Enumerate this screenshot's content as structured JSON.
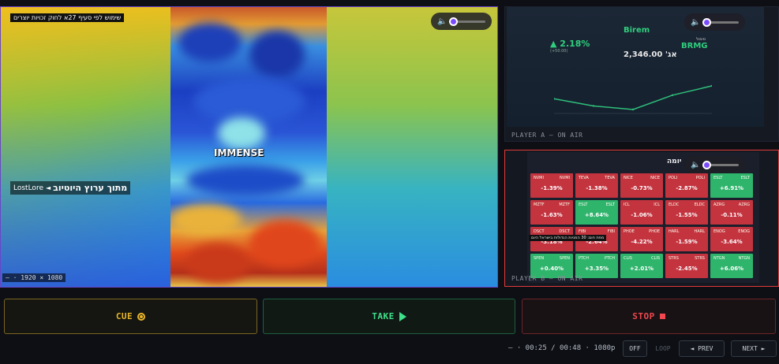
{
  "main_preview": {
    "caption": "שימוש לפי סעיף 27א לחוק זכויות יוצרים",
    "source_tag": {
      "source": "LostLore",
      "text": "מתוך ערוץ היוטיוב"
    },
    "overlay_word": "IMMENSE",
    "resolution": "— · 1920 × 1080",
    "volume_icon": "speaker-icon"
  },
  "player_a": {
    "label": "PLAYER A — ON AIR",
    "ticker": {
      "change_pct": "▲ 2.18%",
      "change_sub": "(+50.00)",
      "company_latin": "Birem",
      "price": "2,346.00 'אג",
      "small_label": "סימול",
      "symbol": "BRMG"
    },
    "chart_data": {
      "type": "line",
      "x": [
        1,
        2,
        3,
        4,
        5
      ],
      "values": [
        2310,
        2290,
        2280,
        2320,
        2346
      ]
    }
  },
  "player_b": {
    "label": "PLAYER B — ON AIR",
    "title": "יומה",
    "overlay": "מפת חום: 30 המניות הגדולות בישראל היום",
    "cells": [
      {
        "t": "NVMI",
        "t2": "NVMI",
        "v": "-1.39%",
        "c": "r"
      },
      {
        "t": "TEVA",
        "t2": "TEVA",
        "v": "-1.38%",
        "c": "r"
      },
      {
        "t": "NICE",
        "t2": "NICE",
        "v": "-0.73%",
        "c": "r"
      },
      {
        "t": "POLI",
        "t2": "POLI",
        "v": "-2.87%",
        "c": "r"
      },
      {
        "t": "ESLT",
        "t2": "ESLT",
        "v": "+6.91%",
        "c": "g"
      },
      {
        "t": "MZTF",
        "t2": "MZTF",
        "v": "-1.63%",
        "c": "r"
      },
      {
        "t": "ESLT",
        "t2": "ESLT",
        "v": "+8.64%",
        "c": "g"
      },
      {
        "t": "ICL",
        "t2": "ICL",
        "v": "-1.06%",
        "c": "r"
      },
      {
        "t": "ELDC",
        "t2": "ELDC",
        "v": "-1.55%",
        "c": "r"
      },
      {
        "t": "AZRG",
        "t2": "AZRG",
        "v": "-0.11%",
        "c": "r"
      },
      {
        "t": "DSCT",
        "t2": "DSCT",
        "v": "-3.18%",
        "c": "r"
      },
      {
        "t": "FIBI",
        "t2": "FIBI",
        "v": "-2.64%",
        "c": "r"
      },
      {
        "t": "PHOE",
        "t2": "PHOE",
        "v": "-4.22%",
        "c": "r"
      },
      {
        "t": "HARL",
        "t2": "HARL",
        "v": "-1.59%",
        "c": "r"
      },
      {
        "t": "ENOG",
        "t2": "ENOG",
        "v": "-3.64%",
        "c": "r"
      },
      {
        "t": "SPEN",
        "t2": "SPEN",
        "v": "+0.40%",
        "c": "g"
      },
      {
        "t": "PTCH",
        "t2": "PTCH",
        "v": "+3.35%",
        "c": "g"
      },
      {
        "t": "CLIS",
        "t2": "CLIS",
        "v": "+2.01%",
        "c": "g"
      },
      {
        "t": "STRS",
        "t2": "STRS",
        "v": "-2.45%",
        "c": "r"
      },
      {
        "t": "NTGN",
        "t2": "NTGN",
        "v": "+6.06%",
        "c": "g"
      }
    ]
  },
  "controls": {
    "cue": "CUE",
    "take": "TAKE",
    "stop": "STOP"
  },
  "transport": {
    "status": "— · 00:25 / 00:48 · 1080p",
    "off": "OFF",
    "loop": "LOOP",
    "prev": "◄ PREV",
    "next": "NEXT ►"
  },
  "colors": {
    "cue": "#e8b52a",
    "take": "#3fe08a",
    "stop": "#f0484e",
    "preview_border": "#6a46c9",
    "program_border": "#e23a3a"
  }
}
